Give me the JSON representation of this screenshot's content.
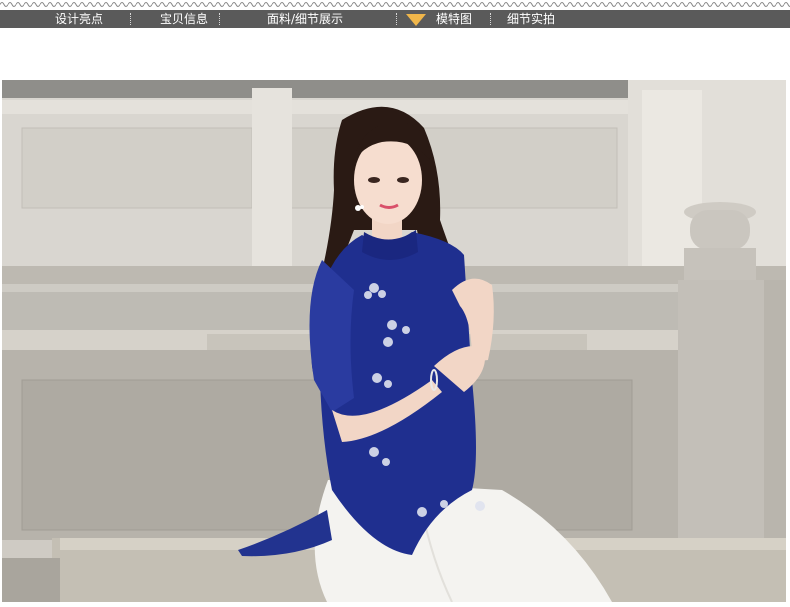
{
  "nav": {
    "items": [
      {
        "label": "设计亮点"
      },
      {
        "label": "宝贝信息"
      },
      {
        "label": "面料/细节展示"
      },
      {
        "label": "模特图"
      },
      {
        "label": "细节实拍"
      }
    ],
    "active_index": 3,
    "colors": {
      "bar": "#5a5a5a",
      "text": "#ffffff",
      "pointer": "#f0b64a"
    }
  },
  "photo": {
    "subject": "model-photo",
    "colors": {
      "stone": "#c9c5bf",
      "top": "#1f2f8f",
      "skirt": "#f4f3f0",
      "hair": "#2a1a14"
    }
  }
}
